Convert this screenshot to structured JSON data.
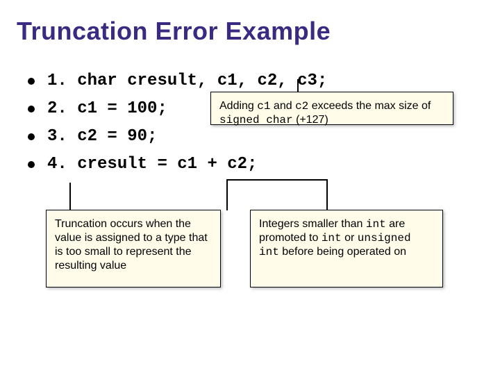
{
  "title": "Truncation Error Example",
  "lines": {
    "l1": {
      "num": "1. ",
      "code": "char cresult, c1, c2, c3;"
    },
    "l2": {
      "num": "2. ",
      "code": "c1 = 100;"
    },
    "l3": {
      "num": "3. ",
      "code": "c2 = 90;"
    },
    "l4": {
      "num": "4. ",
      "code": "cresult = c1 + c2;"
    }
  },
  "callouts": {
    "c1": {
      "pre": "Adding ",
      "m1": "c1",
      "mid1": " and ",
      "m2": "c2",
      "mid2": " exceeds the max size of ",
      "m3": "signed char",
      "post": " (+127)"
    },
    "c2": "Truncation occurs when the value is assigned to a type that is too small to represent the resulting value",
    "c3": {
      "pre": "Integers smaller than ",
      "m1": "int",
      "mid1": " are promoted to ",
      "m2": "int",
      "mid2": " or ",
      "m3": "unsigned int",
      "post": " before being operated on"
    }
  }
}
